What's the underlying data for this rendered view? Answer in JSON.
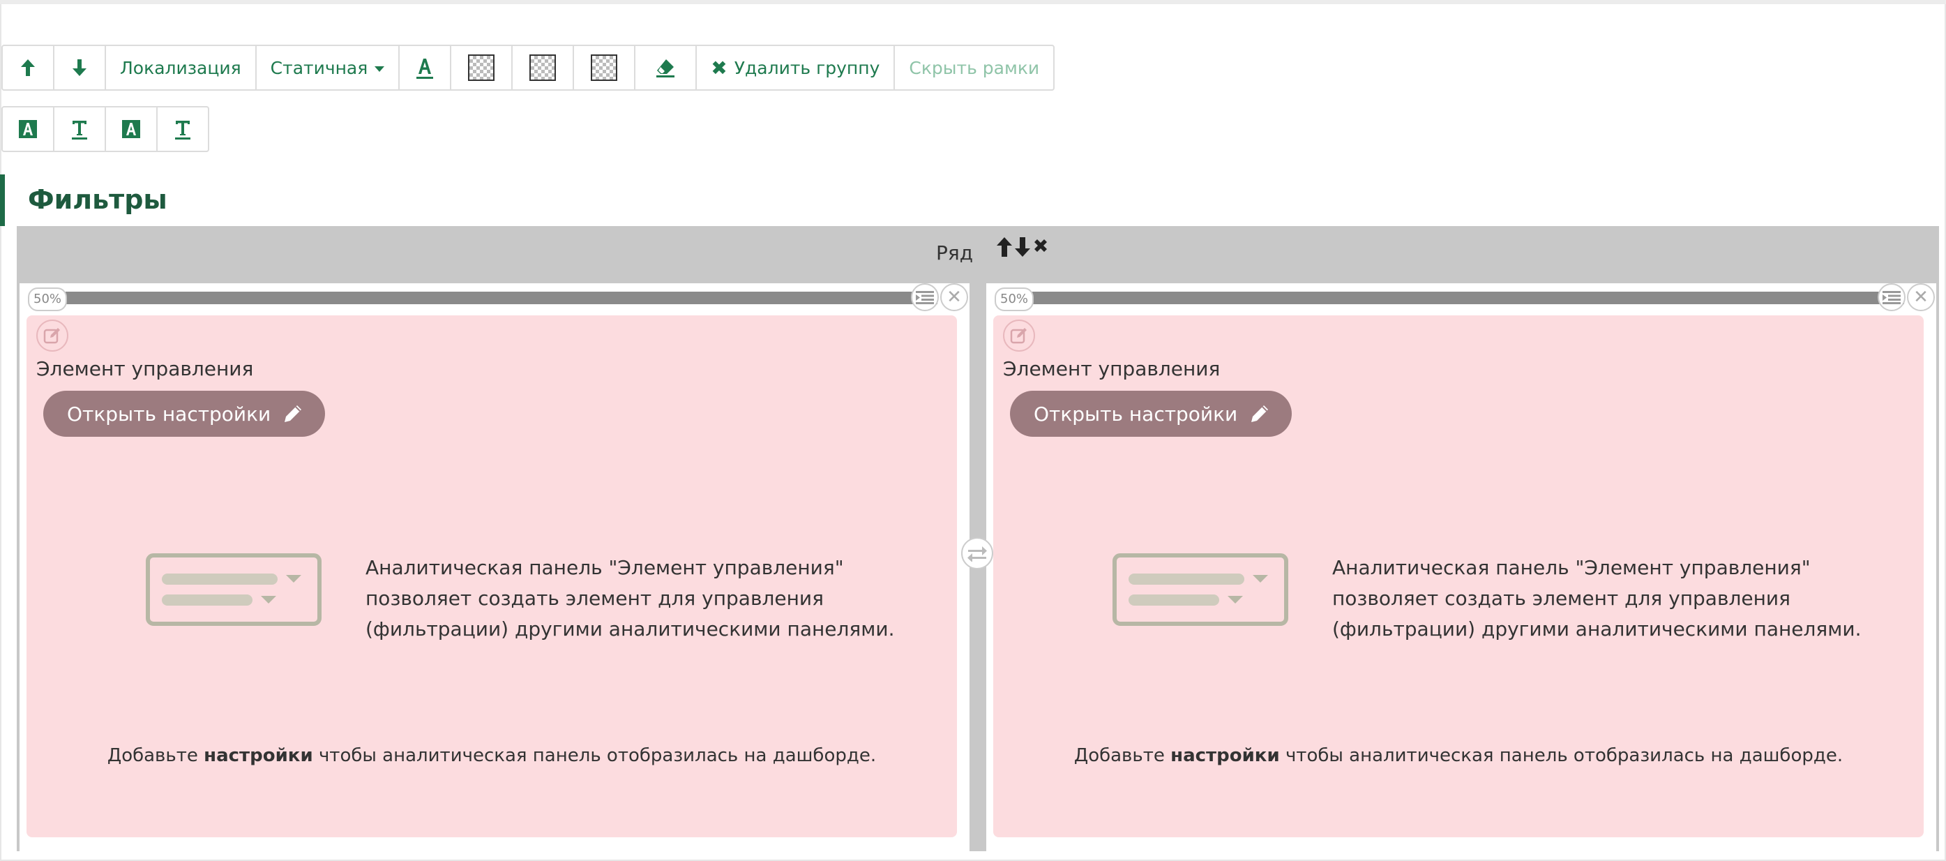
{
  "toolbar": {
    "localization_label": "Локализация",
    "static_label": "Статичная",
    "delete_group_label": "Удалить группу",
    "hide_borders_label": "Скрыть рамки"
  },
  "section": {
    "title": "Фильтры"
  },
  "row": {
    "label": "Ряд"
  },
  "columns": [
    {
      "width_badge": "50%",
      "panel_name": "Элемент управления",
      "open_settings_label": "Открыть настройки",
      "description": "Аналитическая панель \"Элемент управления\" позволяет создать элемент для управления (фильтрации) другими аналитическими панелями.",
      "hint_prefix": "Добавьте",
      "hint_bold": "настройки",
      "hint_suffix": "чтобы аналитическая панель отобразилась на дашборде."
    },
    {
      "width_badge": "50%",
      "panel_name": "Элемент управления",
      "open_settings_label": "Открыть настройки",
      "description": "Аналитическая панель \"Элемент управления\" позволяет создать элемент для управления (фильтрации) другими аналитическими панелями.",
      "hint_prefix": "Добавьте",
      "hint_bold": "настройки",
      "hint_suffix": "чтобы аналитическая панель отобразилась на дашборде."
    }
  ],
  "colors": {
    "accent": "#1e7a4e",
    "panel_bg": "#fcdcdf",
    "open_button": "#9c7b7f",
    "row_bg": "#c8c8c8"
  },
  "icons": [
    "arrow-up-icon",
    "arrow-down-icon",
    "text-color-icon",
    "transparency-icon",
    "eraser-icon",
    "close-icon",
    "text-background-icon",
    "text-underline-icon",
    "edit-icon",
    "pencil-icon",
    "list-icon",
    "swap-icon",
    "control-element-illustration"
  ]
}
